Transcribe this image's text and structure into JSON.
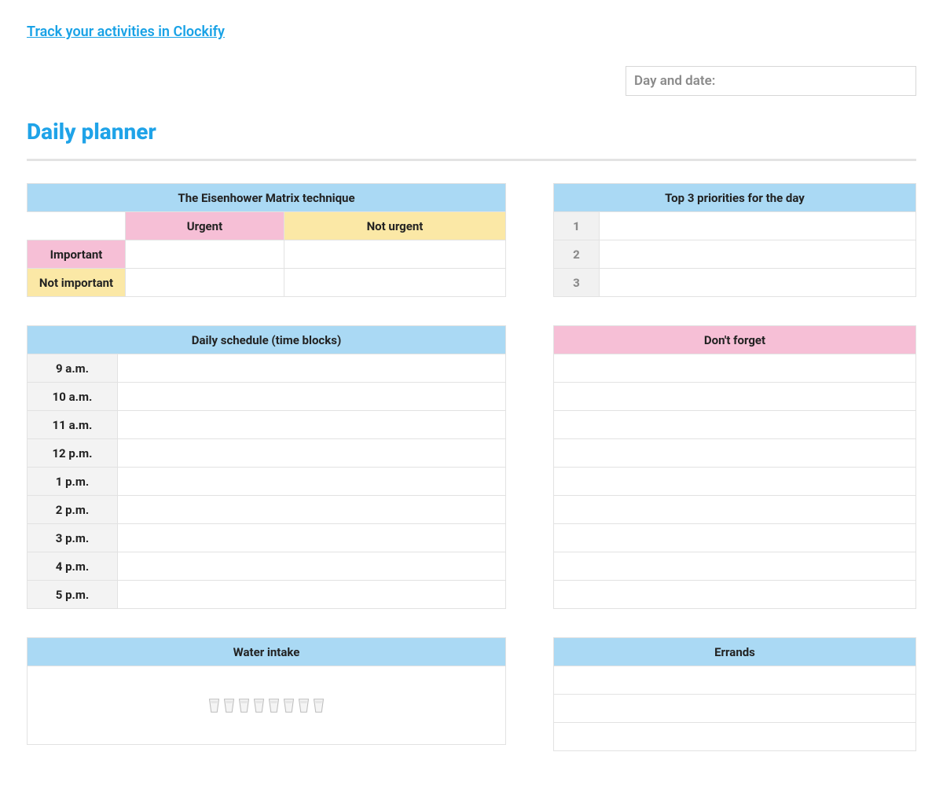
{
  "top_link": "Track your activities in Clockify",
  "date_placeholder": "Day and date:",
  "title": "Daily planner",
  "matrix": {
    "header": "The Eisenhower Matrix technique",
    "cols": [
      "Urgent",
      "Not urgent"
    ],
    "rows": [
      "Important",
      "Not important"
    ],
    "cells": [
      [
        "",
        ""
      ],
      [
        "",
        ""
      ]
    ]
  },
  "priorities": {
    "header": "Top 3 priorities for the day",
    "items": [
      {
        "n": "1",
        "text": ""
      },
      {
        "n": "2",
        "text": ""
      },
      {
        "n": "3",
        "text": ""
      }
    ]
  },
  "schedule": {
    "header": "Daily schedule (time blocks)",
    "slots": [
      {
        "label": "9 a.m.",
        "text": ""
      },
      {
        "label": "10 a.m.",
        "text": ""
      },
      {
        "label": "11 a.m.",
        "text": ""
      },
      {
        "label": "12 p.m.",
        "text": ""
      },
      {
        "label": "1 p.m.",
        "text": ""
      },
      {
        "label": "2 p.m.",
        "text": ""
      },
      {
        "label": "3 p.m.",
        "text": ""
      },
      {
        "label": "4 p.m.",
        "text": ""
      },
      {
        "label": "5 p.m.",
        "text": ""
      }
    ]
  },
  "dont_forget": {
    "header": "Don't forget",
    "items": [
      "",
      "",
      "",
      "",
      "",
      "",
      "",
      "",
      ""
    ]
  },
  "water": {
    "header": "Water intake",
    "cups": 8
  },
  "errands": {
    "header": "Errands",
    "items": [
      "",
      "",
      ""
    ]
  }
}
